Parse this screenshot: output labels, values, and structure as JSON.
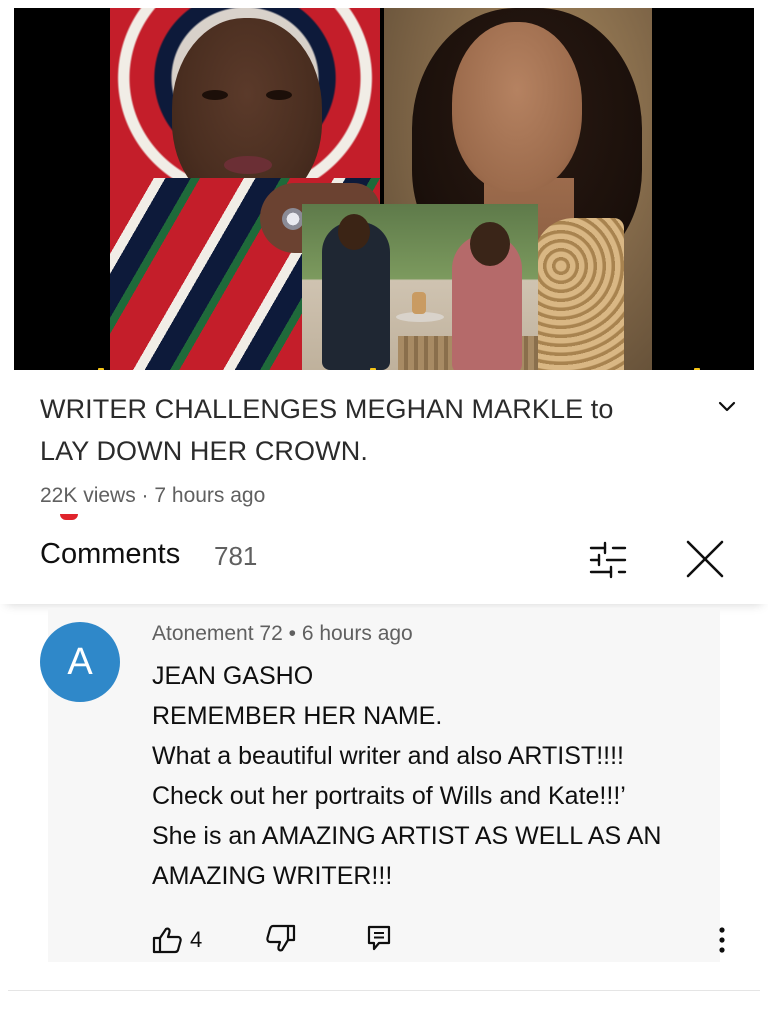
{
  "video": {
    "title_line1": "WRITER CHALLENGES MEGHAN MARKLE to",
    "title_line2": "LAY DOWN HER CROWN.",
    "stats": "22K views · 7 hours ago"
  },
  "comments_header": {
    "title": "Comments",
    "count": "781"
  },
  "comment": {
    "avatar_letter": "A",
    "avatar_color": "#2f88c9",
    "author": "Atonement 72",
    "separator": "•",
    "time": "6 hours ago",
    "lines": [
      "JEAN GASHO",
      "REMEMBER HER NAME.",
      "What a beautiful writer and also ARTIST!!!!",
      "Check out her portraits of Wills and Kate!!!’",
      "She is an AMAZING ARTIST AS WELL AS AN",
      "AMAZING WRITER!!!"
    ],
    "like_count": "4"
  },
  "icons": {
    "expand": "chevron-down-icon",
    "filter": "filter-sliders-icon",
    "close": "close-icon",
    "like": "thumbs-up-icon",
    "dislike": "thumbs-down-icon",
    "reply": "reply-comment-icon",
    "more": "more-vertical-icon"
  }
}
